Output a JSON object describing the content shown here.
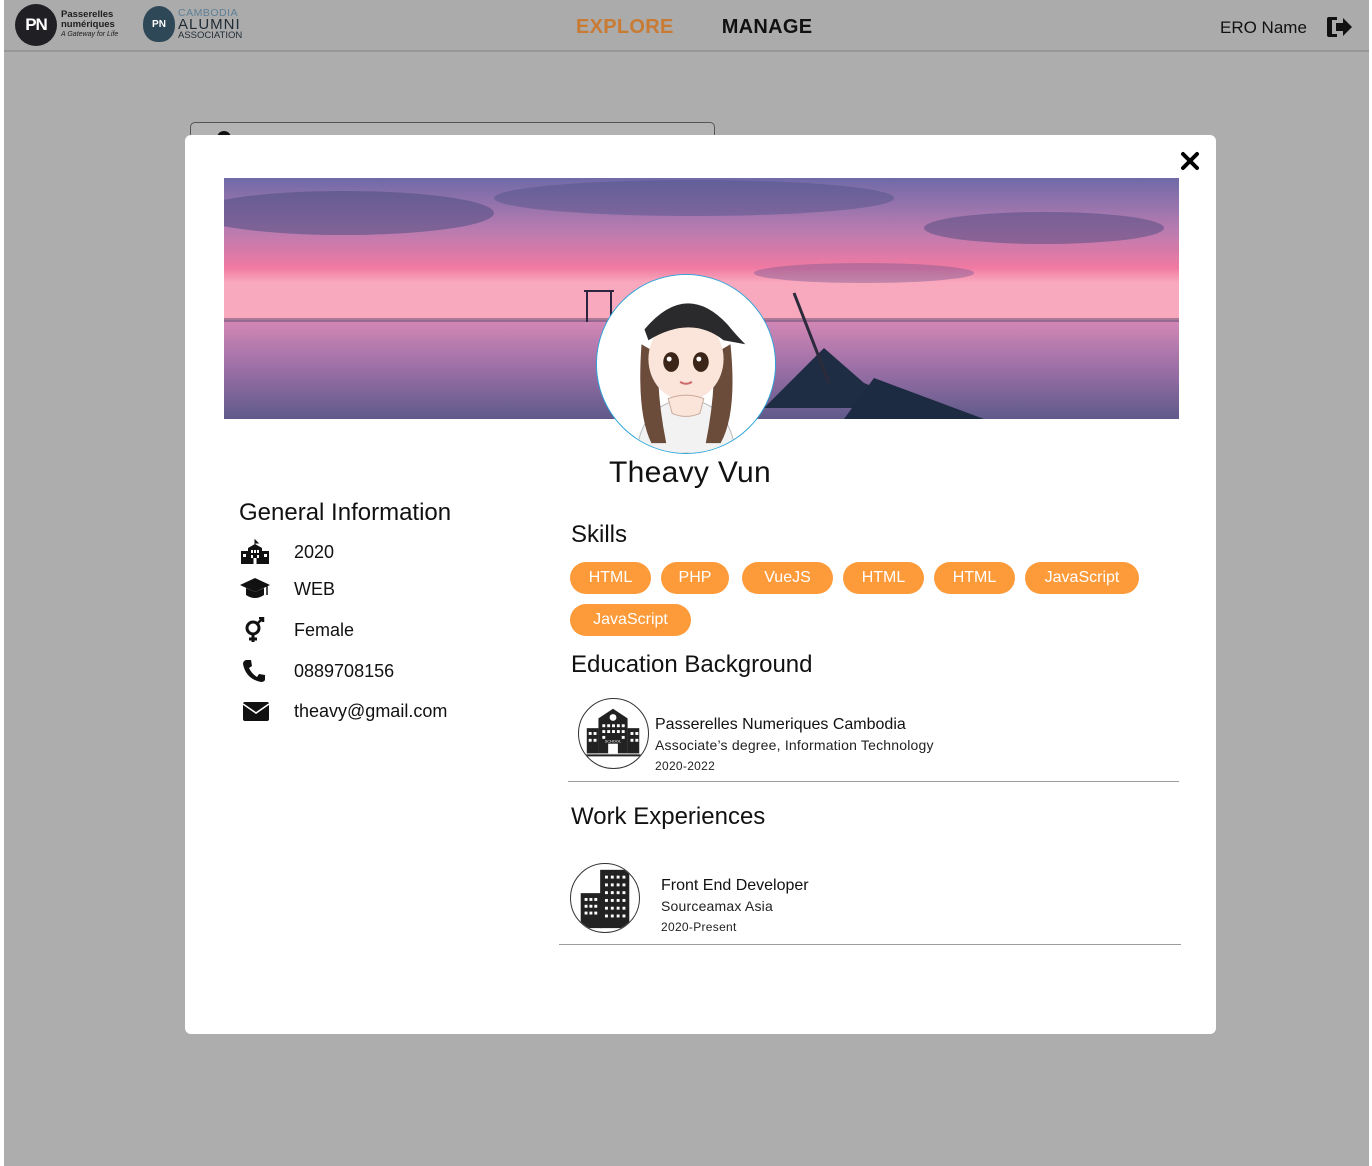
{
  "navbar": {
    "pn_logo": {
      "badge": "PN",
      "line1": "Passerelles",
      "line2": "numériques",
      "tagline": "A Gateway for Life"
    },
    "alumni_logo": {
      "badge": "PN",
      "line1": "CAMBODIA",
      "line2": "ALUMNI",
      "line3": "ASSOCIATION"
    },
    "links": [
      {
        "label": "EXPLORE",
        "active": true
      },
      {
        "label": "MANAGE",
        "active": false
      }
    ],
    "user_name": "ERO Name",
    "logout_icon": "sign-out-icon"
  },
  "modal": {
    "close_icon": "close-icon",
    "profile_name": "Theavy Vun",
    "general": {
      "title": "General Information",
      "rows": [
        {
          "icon": "school-building-icon",
          "value": "2020"
        },
        {
          "icon": "graduation-cap-icon",
          "value": "WEB"
        },
        {
          "icon": "gender-icon",
          "value": "Female"
        },
        {
          "icon": "phone-icon",
          "value": "0889708156"
        },
        {
          "icon": "envelope-icon",
          "value": "theavy@gmail.com"
        }
      ]
    },
    "skills": {
      "title": "Skills",
      "items": [
        "HTML",
        "PHP",
        "VueJS",
        "HTML",
        "HTML",
        "JavaScript",
        "JavaScript"
      ]
    },
    "education": {
      "title": "Education Background",
      "items": [
        {
          "school": "Passerelles Numeriques Cambodia",
          "degree": "Associate’s degree, Information Technology",
          "period": "2020-2022",
          "logo_text": "SCHOOL"
        }
      ]
    },
    "work": {
      "title": "Work Experiences",
      "items": [
        {
          "position": "Front End Developer",
          "company": "Sourceamax Asia",
          "period": "2020-Present"
        }
      ]
    }
  },
  "colors": {
    "accent_orange": "#fd9b3b",
    "active_nav": "#c97a33",
    "avatar_border": "#2aa4d9",
    "overlay": "#adadad"
  }
}
